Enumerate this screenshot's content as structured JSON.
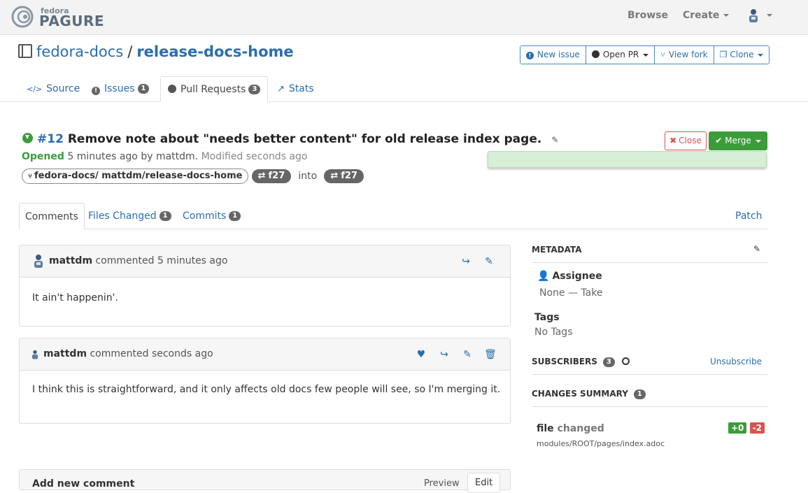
{
  "brand": {
    "top": "fedora",
    "name": "PAGURE"
  },
  "nav": {
    "browse": "Browse",
    "create": "Create"
  },
  "repo": {
    "namespace": "fedora-docs",
    "separator": "/",
    "name": "release-docs-home"
  },
  "repo_actions": {
    "new_issue": "New issue",
    "open_pr": "Open PR",
    "view_fork": "View fork",
    "clone": "Clone"
  },
  "tabs": {
    "source": "Source",
    "issues": "Issues",
    "issues_count": "1",
    "pull_requests": "Pull Requests",
    "pr_count": "3",
    "stats": "Stats"
  },
  "pr": {
    "number": "#12",
    "title": "Remove note about \"needs better content\" for old release index page.",
    "status": "Opened",
    "opened_time": "5 minutes ago by mattdm.",
    "modified": "Modified seconds ago",
    "source_branch": "fedora-docs/ mattdm/release-docs-home",
    "source_ref": "f27",
    "into": "into",
    "target_ref": "f27",
    "close": "Close",
    "merge": "Merge"
  },
  "subtabs": {
    "comments": "Comments",
    "files_changed": "Files Changed",
    "files_count": "1",
    "commits": "Commits",
    "commits_count": "1",
    "patch": "Patch"
  },
  "comments": [
    {
      "author": "mattdm",
      "action": "commented 5 minutes ago",
      "body": "It ain't happenin'."
    },
    {
      "author": "mattdm",
      "action": "commented seconds ago",
      "body": "I think this is straightforward, and it only affects old docs few people will see, so I'm merging it."
    }
  ],
  "add_comment": {
    "title": "Add new comment",
    "preview": "Preview",
    "edit": "Edit"
  },
  "sidebar": {
    "metadata": "METADATA",
    "assignee_label": "Assignee",
    "assignee_value": "None — Take",
    "tags_label": "Tags",
    "tags_value": "No Tags",
    "subscribers": "SUBSCRIBERS",
    "subscribers_count": "3",
    "unsubscribe": "Unsubscribe",
    "changes_summary": "CHANGES SUMMARY",
    "changes_count": "1",
    "file_word": "file",
    "changed_word": "changed",
    "plus": "+0",
    "minus": "-2",
    "file_path": "modules/ROOT/pages/index.adoc"
  },
  "colors": {
    "link": "#2a6eb0",
    "success": "#3a9d3a",
    "danger": "#d9534f",
    "badge": "#666666"
  }
}
